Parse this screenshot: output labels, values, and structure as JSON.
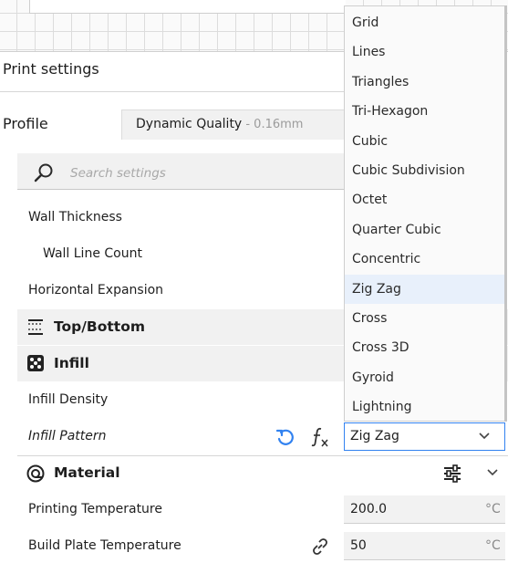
{
  "panel": {
    "title": "Print settings"
  },
  "profile": {
    "label": "Profile",
    "name": "Dynamic Quality",
    "layer": " - 0.16mm"
  },
  "search": {
    "placeholder": "Search settings"
  },
  "settings": {
    "wall_thickness": "Wall Thickness",
    "wall_line_count": "Wall Line Count",
    "horizontal_expansion": "Horizontal Expansion",
    "top_bottom": "Top/Bottom",
    "infill": "Infill",
    "infill_density": "Infill Density",
    "infill_pattern": "Infill Pattern",
    "material": "Material",
    "printing_temperature": "Printing Temperature",
    "printing_temperature_value": "200.0",
    "printing_temperature_unit": "°C",
    "build_plate_temperature": "Build Plate Temperature",
    "build_plate_temperature_value": "50",
    "build_plate_temperature_unit": "°C"
  },
  "infill_pattern_dropdown": {
    "selected": "Zig Zag",
    "options": [
      "Grid",
      "Lines",
      "Triangles",
      "Tri-Hexagon",
      "Cubic",
      "Cubic Subdivision",
      "Octet",
      "Quarter Cubic",
      "Concentric",
      "Zig Zag",
      "Cross",
      "Cross 3D",
      "Gyroid",
      "Lightning"
    ]
  },
  "icons": {
    "search": "magnifier-icon",
    "top_bottom": "top-bottom-icon",
    "infill": "infill-icon",
    "material": "material-spool-icon",
    "reset": "reset-icon",
    "function": "function-icon",
    "link": "link-icon",
    "adjust": "sliders-icon",
    "chevron": "chevron-down-icon"
  },
  "colors": {
    "accent": "#3282f0",
    "reset_icon": "#3282f0",
    "selection": "#e8f0fb"
  }
}
